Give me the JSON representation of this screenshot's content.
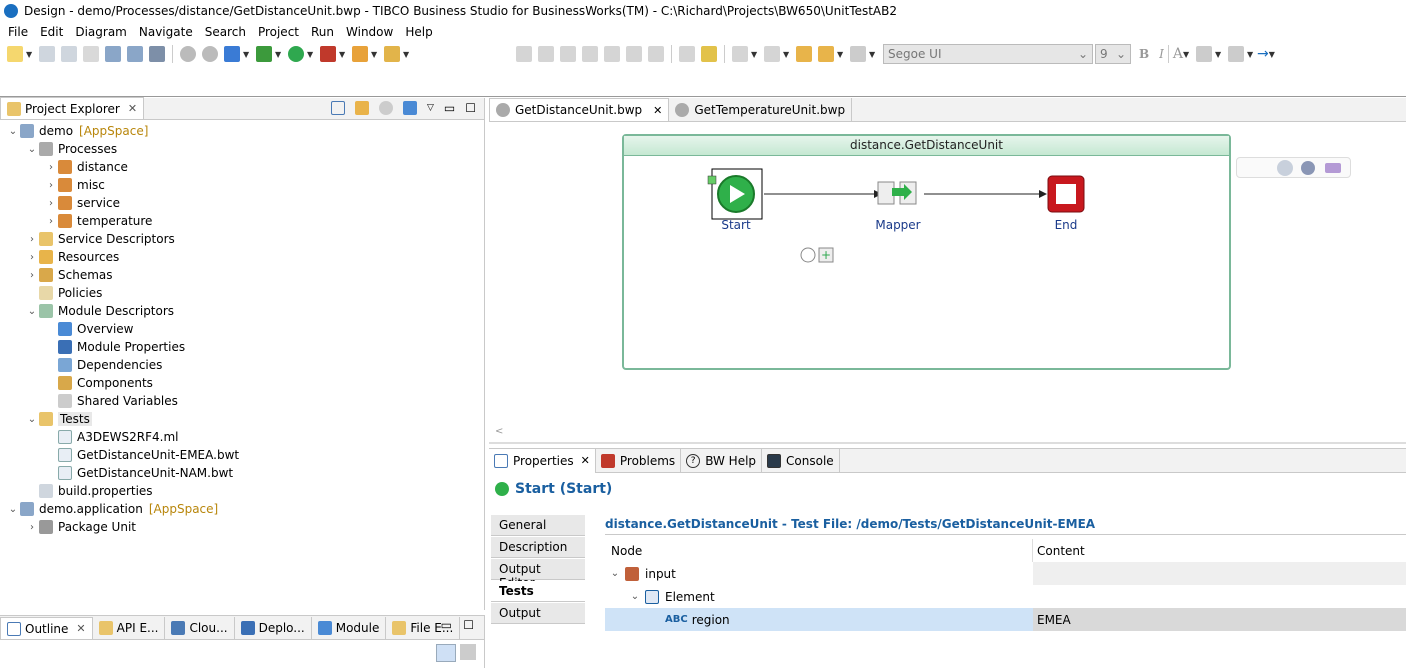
{
  "window": {
    "title": "Design - demo/Processes/distance/GetDistanceUnit.bwp - TIBCO Business Studio for BusinessWorks(TM) - C:\\Richard\\Projects\\BW650\\UnitTestAB2"
  },
  "menu": [
    "File",
    "Edit",
    "Diagram",
    "Navigate",
    "Search",
    "Project",
    "Run",
    "Window",
    "Help"
  ],
  "toolbar": {
    "font": "Segoe UI",
    "size": "9",
    "bold": "B",
    "italic": "I",
    "font_color": "A"
  },
  "project_explorer": {
    "title": "Project Explorer",
    "items": [
      {
        "label": "demo",
        "suffix": "[AppSpace]",
        "level": 0,
        "twisty": "open",
        "icon": "appspace-icon"
      },
      {
        "label": "Processes",
        "level": 1,
        "twisty": "open",
        "icon": "processes-icon"
      },
      {
        "label": "distance",
        "level": 2,
        "twisty": "closed",
        "icon": "package-icon"
      },
      {
        "label": "misc",
        "level": 2,
        "twisty": "closed",
        "icon": "package-icon"
      },
      {
        "label": "service",
        "level": 2,
        "twisty": "closed",
        "icon": "package-icon"
      },
      {
        "label": "temperature",
        "level": 2,
        "twisty": "closed",
        "icon": "package-icon"
      },
      {
        "label": "Service Descriptors",
        "level": 1,
        "twisty": "closed",
        "icon": "folder-icon"
      },
      {
        "label": "Resources",
        "level": 1,
        "twisty": "closed",
        "icon": "resources-icon"
      },
      {
        "label": "Schemas",
        "level": 1,
        "twisty": "closed",
        "icon": "schemas-icon"
      },
      {
        "label": "Policies",
        "level": 1,
        "twisty": "none",
        "icon": "policies-icon"
      },
      {
        "label": "Module Descriptors",
        "level": 1,
        "twisty": "open",
        "icon": "module-icon"
      },
      {
        "label": "Overview",
        "level": 2,
        "twisty": "none",
        "icon": "overview-icon"
      },
      {
        "label": "Module Properties",
        "level": 2,
        "twisty": "none",
        "icon": "properties-icon"
      },
      {
        "label": "Dependencies",
        "level": 2,
        "twisty": "none",
        "icon": "dependencies-icon"
      },
      {
        "label": "Components",
        "level": 2,
        "twisty": "none",
        "icon": "components-icon"
      },
      {
        "label": "Shared Variables",
        "level": 2,
        "twisty": "none",
        "icon": "variables-icon"
      },
      {
        "label": "Tests",
        "level": 1,
        "twisty": "open",
        "icon": "tests-folder-icon",
        "selected": true
      },
      {
        "label": "A3DEWS2RF4.ml",
        "level": 2,
        "twisty": "none",
        "icon": "file-icon"
      },
      {
        "label": "GetDistanceUnit-EMEA.bwt",
        "level": 2,
        "twisty": "none",
        "icon": "file-icon"
      },
      {
        "label": "GetDistanceUnit-NAM.bwt",
        "level": 2,
        "twisty": "none",
        "icon": "file-icon"
      },
      {
        "label": "build.properties",
        "level": 1,
        "twisty": "none",
        "icon": "properties-file-icon"
      },
      {
        "label": "demo.application",
        "suffix": "[AppSpace]",
        "level": 0,
        "twisty": "open",
        "icon": "application-icon"
      },
      {
        "label": "Package Unit",
        "level": 1,
        "twisty": "closed",
        "icon": "package-unit-icon"
      }
    ]
  },
  "bottom_left_tabs": [
    "Outline",
    "API E...",
    "Clou...",
    "Deplo...",
    "Module",
    "File E..."
  ],
  "editor": {
    "tabs": [
      "GetDistanceUnit.bwp",
      "GetTemperatureUnit.bwp"
    ],
    "process_title": "distance.GetDistanceUnit",
    "activities": [
      "Start",
      "Mapper",
      "End"
    ]
  },
  "properties": {
    "tabs": [
      "Properties",
      "Problems",
      "BW Help",
      "Console"
    ],
    "heading": "Start (Start)",
    "side_tabs": [
      "General",
      "Description",
      "Output Editor",
      "Tests",
      "Output"
    ],
    "selected_side_tab": "Tests",
    "test_header": "distance.GetDistanceUnit - Test File: /demo/Tests/GetDistanceUnit-EMEA",
    "columns": [
      "Node",
      "Content"
    ],
    "rows": [
      {
        "node": "input",
        "content": ""
      },
      {
        "node": "Element",
        "content": ""
      },
      {
        "node": "region",
        "content": "EMEA"
      }
    ]
  }
}
